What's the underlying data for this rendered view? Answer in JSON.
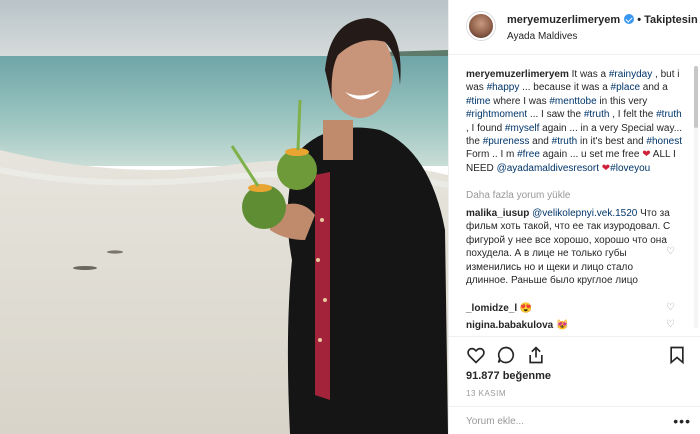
{
  "post": {
    "username": "meryemuzerlimeryem",
    "follow_label": "• Takiptesin",
    "location": "Ayada Maldives",
    "caption": {
      "user": "meryemuzerlimeryem",
      "segments": [
        {
          "t": "It was a "
        },
        {
          "t": "#rainyday",
          "tag": true
        },
        {
          "t": " , but i was "
        },
        {
          "t": "#happy",
          "tag": true
        },
        {
          "t": " ... because it was a "
        },
        {
          "t": "#place",
          "tag": true
        },
        {
          "t": " and a "
        },
        {
          "t": "#time",
          "tag": true
        },
        {
          "t": " where I was "
        },
        {
          "t": "#menttobe",
          "tag": true
        },
        {
          "t": " in this very "
        },
        {
          "t": "#rightmoment",
          "tag": true
        },
        {
          "t": " ... I saw the "
        },
        {
          "t": "#truth",
          "tag": true
        },
        {
          "t": " , I felt the "
        },
        {
          "t": "#truth",
          "tag": true
        },
        {
          "t": " , I found "
        },
        {
          "t": "#myself",
          "tag": true
        },
        {
          "t": " again ... in a very Special way... the "
        },
        {
          "t": "#pureness",
          "tag": true
        },
        {
          "t": " and "
        },
        {
          "t": "#truth",
          "tag": true
        },
        {
          "t": " in it's best and "
        },
        {
          "t": "#honest",
          "tag": true
        },
        {
          "t": " Form .. I m "
        },
        {
          "t": "#free",
          "tag": true
        },
        {
          "t": " again ... u set me free "
        },
        {
          "t": "❤",
          "heart": true
        },
        {
          "t": " ALL I NEED "
        },
        {
          "t": "@ayadamaldivesresort",
          "tag": true
        },
        {
          "t": " "
        },
        {
          "t": "❤",
          "heart": true
        },
        {
          "t": "#loveyou",
          "tag": true
        }
      ]
    },
    "load_more": "Daha fazla yorum yükle",
    "comments": [
      {
        "user": "malika_iusup",
        "mention": "@velikolepnyi.vek.1520",
        "text": "Что за фильм хоть такой, что ее так изуродовал. С фигурой у нее все хорошо, хорошо что она похудела. А в лице не только губы изменились но и щеки и лицо стало длинное. Раньше было круглое лицо"
      },
      {
        "user": "_lomidze_l",
        "text": "😍"
      },
      {
        "user": "nigina.babakulova",
        "text": "😻"
      }
    ],
    "likes": "91.877 beğenme",
    "date": "13 KASIM",
    "comment_placeholder": "Yorum ekle...",
    "more_icon": "•••"
  },
  "icons": {
    "heart": "heart-icon",
    "comment": "comment-icon",
    "share": "share-icon",
    "save": "bookmark-icon",
    "like_small": "small-heart-icon"
  },
  "colors": {
    "link": "#003569",
    "verified": "#3897f0",
    "heart": "#d0213a",
    "muted": "#999999"
  }
}
